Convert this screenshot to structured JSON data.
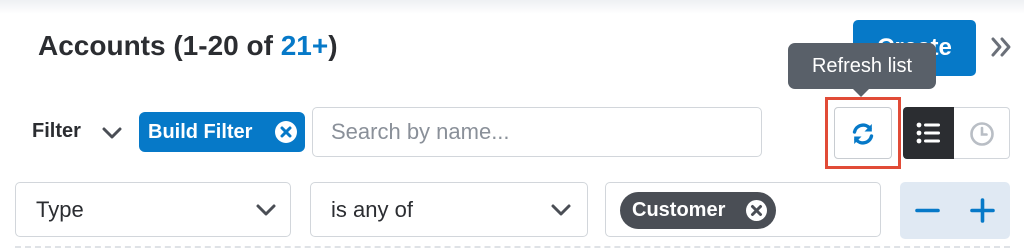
{
  "header": {
    "title_prefix": "Accounts (1-20 of ",
    "title_count": "21+",
    "title_suffix": ")",
    "create_label": "Create",
    "expand_icon": "double-chevron-right-icon"
  },
  "tooltip": {
    "text": "Refresh list"
  },
  "filter_bar": {
    "filter_label": "Filter",
    "build_filter_label": "Build Filter",
    "search_placeholder": "Search by name...",
    "search_value": ""
  },
  "toolbar": {
    "refresh_icon": "refresh-icon",
    "list_view_icon": "list-icon",
    "recent_icon": "clock-icon",
    "highlight_color": "#e14b37"
  },
  "filter_row": {
    "field_value": "Type",
    "operator_value": "is any of",
    "selected_values": [
      "Customer"
    ],
    "remove_row_icon": "minus-icon",
    "add_row_icon": "plus-icon"
  },
  "colors": {
    "accent": "#0679c8",
    "dark": "#2b2d31",
    "tooltip_bg": "#596069"
  }
}
